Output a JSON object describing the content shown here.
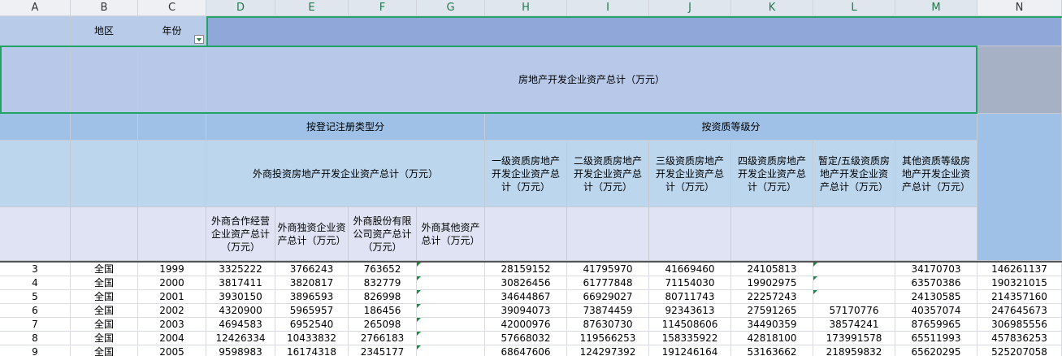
{
  "columns": [
    "A",
    "B",
    "C",
    "D",
    "E",
    "F",
    "G",
    "H",
    "I",
    "J",
    "K",
    "L",
    "M",
    "N"
  ],
  "row1": {
    "region": "地区",
    "year": "年份"
  },
  "title": "房地产开发企业资产总计（万元）",
  "group_reg": "按登记注册类型分",
  "group_qual": "按资质等级分",
  "foreign_total": "外商投资房地产开发企业资产总计（万元）",
  "qual_cols": [
    "一级资质房地产开发企业资产总计（万元）",
    "二级资质房地产开发企业资产总计（万元）",
    "三级资质房地产开发企业资产总计（万元）",
    "四级资质房地产开发企业资产总计（万元）",
    "暂定/五级资质房地产开发企业资产总计（万元）",
    "其他资质等级房地产开发企业资产总计（万元）"
  ],
  "foreign_cols": [
    "外商合作经营企业资产总计（万元）",
    "外商独资企业资产总计（万元）",
    "外商股份有限公司资产总计（万元）",
    "外商其他资产总计（万元）"
  ],
  "rows": [
    {
      "a": "3",
      "b": "全国",
      "c": "1999",
      "d": "3325222",
      "e": "3766243",
      "f": "763652",
      "g": "",
      "h": "28159152",
      "i": "41795970",
      "j": "41669460",
      "k": "24105813",
      "l": "",
      "m": "34170703",
      "n": "146261137"
    },
    {
      "a": "4",
      "b": "全国",
      "c": "2000",
      "d": "3817411",
      "e": "3820817",
      "f": "832779",
      "g": "",
      "h": "30826456",
      "i": "61777848",
      "j": "71154030",
      "k": "19902975",
      "l": "",
      "m": "63570386",
      "n": "190321015"
    },
    {
      "a": "5",
      "b": "全国",
      "c": "2001",
      "d": "3930150",
      "e": "3896593",
      "f": "826998",
      "g": "",
      "h": "34644867",
      "i": "66929027",
      "j": "80711743",
      "k": "22257243",
      "l": "",
      "m": "24130585",
      "n": "214357160"
    },
    {
      "a": "6",
      "b": "全国",
      "c": "2002",
      "d": "4320900",
      "e": "5965957",
      "f": "186456",
      "g": "",
      "h": "39094073",
      "i": "73874459",
      "j": "92343613",
      "k": "27591265",
      "l": "57170776",
      "m": "40357074",
      "n": "247645673"
    },
    {
      "a": "7",
      "b": "全国",
      "c": "2003",
      "d": "4694583",
      "e": "6952540",
      "f": "265098",
      "g": "",
      "h": "42000976",
      "i": "87630730",
      "j": "114508606",
      "k": "34490359",
      "l": "38574241",
      "m": "87659965",
      "n": "306985556"
    },
    {
      "a": "8",
      "b": "全国",
      "c": "2004",
      "d": "12426334",
      "e": "10433832",
      "f": "2766183",
      "g": "",
      "h": "57668032",
      "i": "119566253",
      "j": "158335922",
      "k": "42818100",
      "l": "173991578",
      "m": "65511993",
      "n": "457836253"
    },
    {
      "a": "9",
      "b": "全国",
      "c": "2005",
      "d": "9598983",
      "e": "16174318",
      "f": "2345177",
      "g": "",
      "h": "68647606",
      "i": "124297392",
      "j": "191246164",
      "k": "53163662",
      "l": "218959832",
      "m": "65620295",
      "n": "525207058"
    }
  ]
}
